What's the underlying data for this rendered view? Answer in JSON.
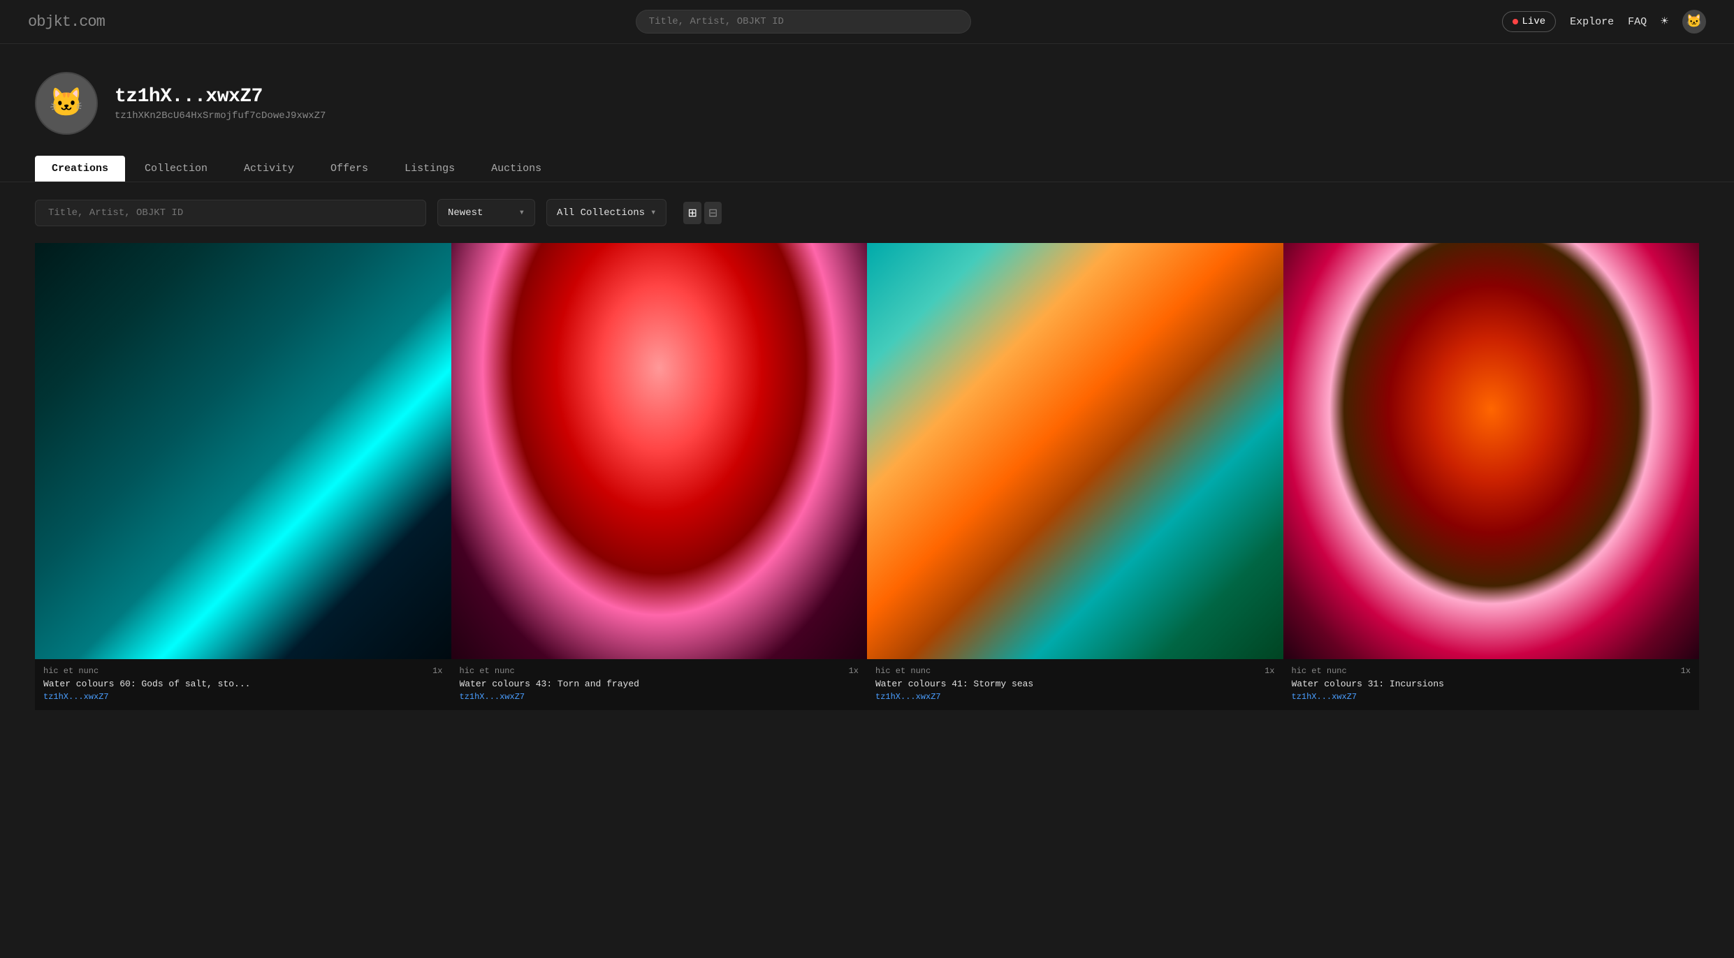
{
  "site": {
    "logo_main": "objkt",
    "logo_suffix": ".com"
  },
  "header": {
    "search_placeholder": "Title, Artist, OBJKT ID",
    "live_label": "Live",
    "explore_label": "Explore",
    "faq_label": "FAQ",
    "sun_icon": "☀",
    "avatar_icon": "🐱"
  },
  "profile": {
    "handle": "tz1hX...xwxZ7",
    "address": "tz1hXKn2BcU64HxSrmojfuf7cDoweJ9xwxZ7",
    "avatar_emoji": "🐱"
  },
  "tabs": [
    {
      "label": "Creations",
      "active": true
    },
    {
      "label": "Collection",
      "active": false
    },
    {
      "label": "Activity",
      "active": false
    },
    {
      "label": "Offers",
      "active": false
    },
    {
      "label": "Listings",
      "active": false
    },
    {
      "label": "Auctions",
      "active": false
    }
  ],
  "filter": {
    "search_placeholder": "Title, Artist, OBJKT ID",
    "sort_label": "Newest",
    "sort_arrow": "▾",
    "collection_label": "All Collections",
    "collection_arrow": "▾",
    "grid_icon_1": "⊞",
    "grid_icon_2": "⊟"
  },
  "artworks": [
    {
      "collection": "hic et nunc",
      "count": "1x",
      "title": "Water colours 60: Gods of salt, sto...",
      "artist": "tz1hX...xwxZ7",
      "style_class": "art-1"
    },
    {
      "collection": "hic et nunc",
      "count": "1x",
      "title": "Water colours 43: Torn and frayed",
      "artist": "tz1hX...xwxZ7",
      "style_class": "art-2"
    },
    {
      "collection": "hic et nunc",
      "count": "1x",
      "title": "Water colours 41: Stormy seas",
      "artist": "tz1hX...xwxZ7",
      "style_class": "art-3"
    },
    {
      "collection": "hic et nunc",
      "count": "1x",
      "title": "Water colours 31: Incursions",
      "artist": "tz1hX...xwxZ7",
      "style_class": "art-4"
    }
  ]
}
